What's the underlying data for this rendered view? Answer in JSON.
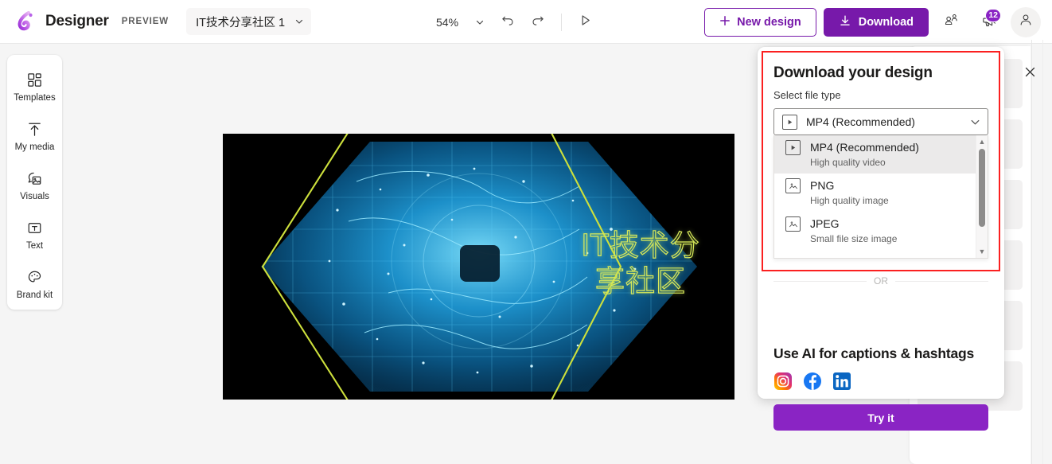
{
  "app": {
    "brand": "Designer",
    "preview_tag": "PREVIEW",
    "logo_icon": "designer-logo-icon"
  },
  "topbar": {
    "document_name": "IT技术分享社区 1",
    "document_chevron_icon": "chevron-down-icon",
    "zoom_level": "54%",
    "zoom_chevron_icon": "chevron-down-icon",
    "undo_icon": "undo-icon",
    "redo_icon": "redo-icon",
    "play_icon": "play-icon",
    "new_design_label": "New design",
    "new_design_icon": "plus-icon",
    "download_label": "Download",
    "download_icon": "download-arrow-icon",
    "share_icon": "share-people-icon",
    "announcements_icon": "megaphone-icon",
    "announcements_badge": "12",
    "account_icon": "person-account-icon"
  },
  "sidebar": {
    "items": [
      {
        "label": "Templates",
        "icon": "templates-grid-icon"
      },
      {
        "label": "My media",
        "icon": "upload-arrow-icon"
      },
      {
        "label": "Visuals",
        "icon": "visuals-image-icon"
      },
      {
        "label": "Text",
        "icon": "text-box-icon"
      },
      {
        "label": "Brand kit",
        "icon": "brand-palette-icon"
      }
    ]
  },
  "canvas": {
    "design_title_line1": "IT技术分",
    "design_title_line2": "享社区",
    "background_color": "#000000",
    "title_stroke_color": "#d7e85a",
    "hex_outline_color": "#cde03c",
    "image_accent_color": "#1ba7e0"
  },
  "dialog": {
    "title": "Download your design",
    "subtitle": "Select file type",
    "close_icon": "close-icon",
    "selected_format": "MP4 (Recommended)",
    "selected_format_icon": "video-play-icon",
    "select_chevron_icon": "chevron-down-icon",
    "options": [
      {
        "name": "MP4 (Recommended)",
        "desc": "High quality video",
        "icon": "video-play-icon",
        "selected": true
      },
      {
        "name": "PNG",
        "desc": "High quality image",
        "icon": "image-icon",
        "selected": false
      },
      {
        "name": "JPEG",
        "desc": "Small file size image",
        "icon": "image-icon",
        "selected": false
      }
    ],
    "scroll_up_icon": "scroll-up-arrow-icon",
    "scroll_down_icon": "scroll-down-arrow-icon",
    "or_text": "OR",
    "ai_title": "Use AI for captions & hashtags",
    "socials": [
      {
        "name": "instagram-icon"
      },
      {
        "name": "facebook-icon"
      },
      {
        "name": "linkedin-icon"
      }
    ],
    "try_it_label": "Try it",
    "accent_color": "#8a24c4",
    "highlight_box_color": "#fb2020"
  }
}
